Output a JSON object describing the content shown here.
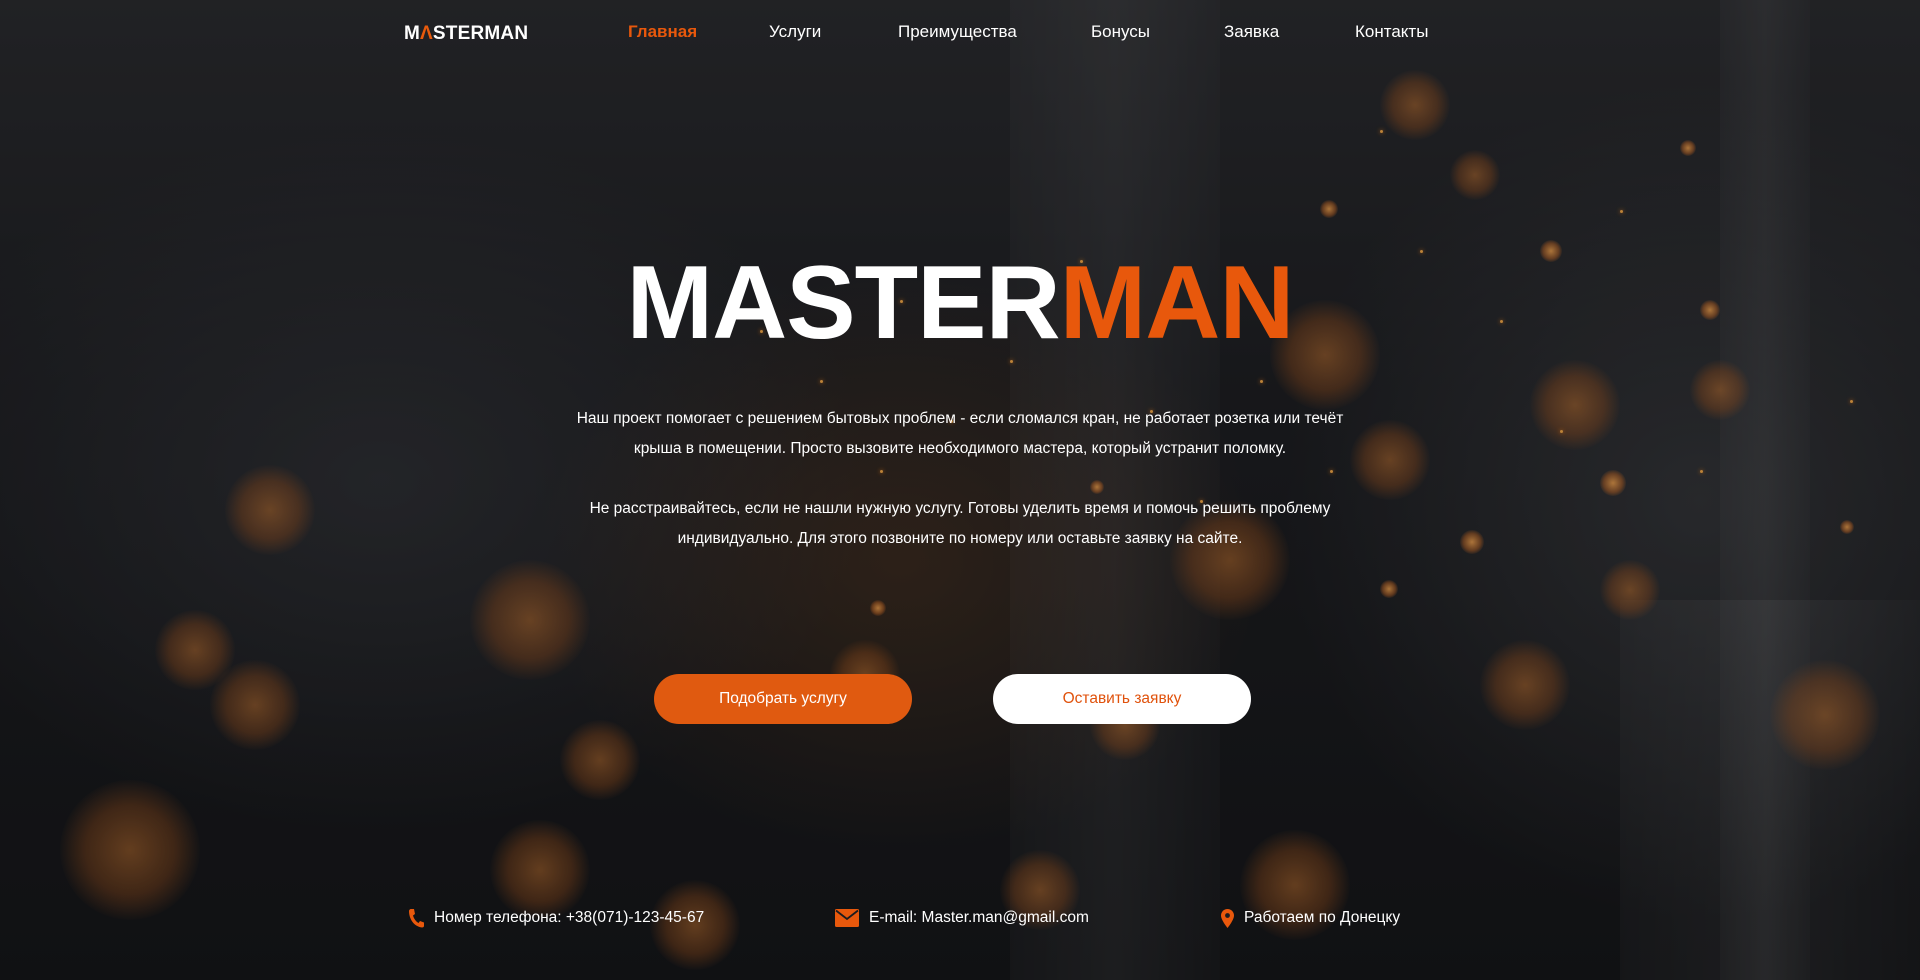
{
  "brand": {
    "logo_text_start": "M",
    "logo_text_mark": "Λ",
    "logo_text_end": "STERMAN",
    "accent_color": "#e8580c"
  },
  "nav": {
    "items": [
      {
        "label": "Главная",
        "active": true
      },
      {
        "label": "Услуги",
        "active": false
      },
      {
        "label": "Преимущества",
        "active": false
      },
      {
        "label": "Бонусы",
        "active": false
      },
      {
        "label": "Заявка",
        "active": false
      },
      {
        "label": "Контакты",
        "active": false
      }
    ]
  },
  "hero": {
    "title_white": "MASTER",
    "title_orange": "MAN",
    "paragraph_1_line_1": "Наш проект помогает с решением бытовых проблем - если сломался кран, не работает розетка или течёт",
    "paragraph_1_line_2": "крыша в помещении. Просто вызовите необходимого мастера, который устранит поломку.",
    "paragraph_2_line_1": "Не расстраивайтесь, если не нашли нужную услугу. Готовы уделить время и помочь решить проблему",
    "paragraph_2_line_2": "индивидуально. Для этого позвоните по номеру или оставьте заявку на сайте.",
    "primary_button": "Подобрать услугу",
    "secondary_button": "Оставить заявку"
  },
  "contacts": {
    "phone": "Номер телефона: +38(071)-123-45-67",
    "email": "E-mail: Master.man@gmail.com",
    "location": "Работаем по Донецку",
    "icons": [
      "phone-icon",
      "mail-icon",
      "location-pin-icon"
    ]
  }
}
